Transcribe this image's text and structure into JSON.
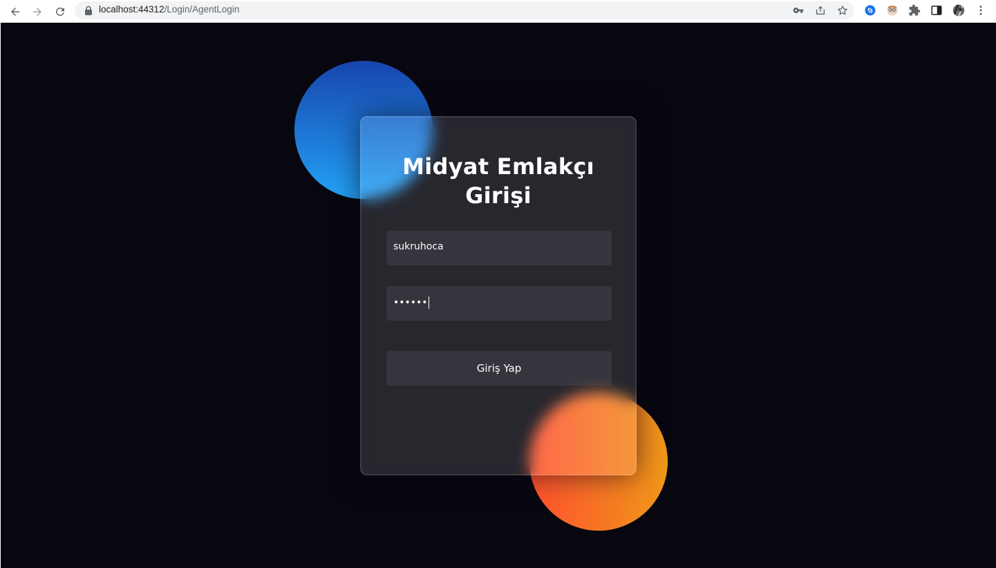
{
  "browser": {
    "url_host": "localhost:44312",
    "url_path": "/Login/AgentLogin",
    "icons": {
      "back": "arrow-left-icon",
      "forward": "arrow-right-icon",
      "reload": "reload-icon",
      "lock": "lock-icon",
      "key": "key-icon",
      "share": "share-icon",
      "star": "star-icon",
      "shazam": "shazam-extension-icon",
      "face": "face-extension-icon",
      "puzzle": "extensions-puzzle-icon",
      "sidepanel": "side-panel-icon",
      "avatar": "profile-avatar",
      "menu": "kebab-menu-icon"
    }
  },
  "login": {
    "title_line1": "Midyat Emlakçı",
    "title_line2": "Girişi",
    "username_value": "sukruhoca",
    "password_value": "••••••",
    "submit_label": "Giriş Yap"
  },
  "colors": {
    "page_bg": "#080710",
    "blue_gradient": [
      "#1845ad",
      "#23a2f6"
    ],
    "orange_gradient": [
      "#ff512f",
      "#f09819"
    ]
  }
}
